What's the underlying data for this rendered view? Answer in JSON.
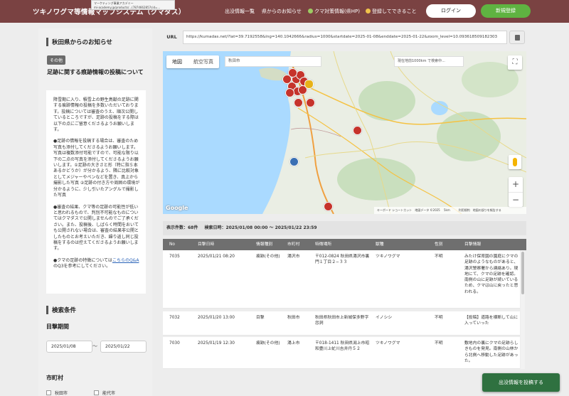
{
  "header": {
    "title": "ツキノワグマ等情報マップシステム（クマダス）",
    "tooltip_line1": "マーケティング事業アカデミー",
    "tooltip_line2": "mi-academy.jp/products/...(7874662857cid=...",
    "nav": [
      "出没情報一覧",
      "県からのお知らせ",
      "クマ対策情報(県HP)",
      "登録してできること"
    ],
    "login": "ログイン",
    "register": "新規登録"
  },
  "sidebar": {
    "title": "秋田県からのお知らせ",
    "badge": "その他",
    "notice_title": "足跡に関する痕跡情報の投稿について",
    "notice_paragraphs": [
      "降雪期に入り、積雪上の野生鳥獣の足跡に関する痕跡情報の投稿を多数いただいております。投稿については審査のうえ、順次公開しているところですが、足跡の投稿をする際は以下の点にご留意くださるようお願いします。",
      "●足跡の情報を投稿する場合は、審査のため写真も添付してくださるようお願いします。写真は複数添付可能ですので、可能な限り以下の二点の写真を添付してくださるようお願いします。①足跡の大きさと形（特に指５本あるかどうか）が分かるよう、隣に比較対象としてメジャーやペンなどを置き、真上から撮影した写真 ②足跡の付き方や周囲の環境が分かるように、少し引いたアングルで撮影した写真",
      "●審査の結果、クマ等の足跡の可能性が低いと思われるもので、判別不可能なものについてはクマダスで公開しませんのでご了承ください。また、投稿後、しばらく時間をおいても公開されない場合は、審査の結果非公開としたものとお考えいただき、繰り返し同じ投稿をするのは控えてくださるようお願いします。"
    ],
    "notice_last_prefix": "●クマの足跡の特徴については",
    "notice_link": "こちらのQ&A",
    "notice_last_suffix": "のQ3を参考にしてください。",
    "search_title": "検索条件",
    "period_label": "目撃期間",
    "date_from": "2025/01/08",
    "date_sep": "〜",
    "date_to": "2025/01/22",
    "city_label": "市町村",
    "cities": [
      "秋田市",
      "能代市"
    ]
  },
  "url": {
    "label": "URL",
    "value": "https://kumadas.net/?lat=39.7192558&lng=140.1042666&radius=1000&startdate=2025-01-08&enddate=2025-01-22&zoom_level=10.093618509182303"
  },
  "map": {
    "tab_map": "地図",
    "tab_satellite": "航空写真",
    "search_value": "秋田市",
    "radius_placeholder": "現在地前1000km で検索中...",
    "google": "Google",
    "attribution": "キーボード ショートカット　地図データ ©2025 　5km　　　利用規約　地図の誤りを報告する"
  },
  "summary": {
    "count": "表示件数：68件",
    "period": "検索日時：2025/01/08 00:00 〜 2025/01/22 23:59"
  },
  "table": {
    "headers": [
      "No",
      "目撃日時",
      "情報種別",
      "市町村",
      "特徴場所",
      "獣種",
      "性別",
      "目撃情報"
    ],
    "rows": [
      [
        "7035",
        "2025/01/21 08:20",
        "痕跡(その他)",
        "湯沢市",
        "〒012-0824 秋田県湯沢市裏門１丁目２−３３",
        "ツキノワグマ",
        "不明",
        "みたけ保育園の園庭にクマの足跡のようなものがあると、湯沢警察署から連絡あり。現地にて、クマの足跡を確認。南側の山に足跡が続いているため、クマは山に戻ったと思われる。"
      ],
      [
        "7032",
        "2025/01/20 13:00",
        "目撃",
        "秋田市",
        "秋田県秋田市上新城保多野字怨洞",
        "イノシシ",
        "不明",
        "【投稿】道路を横断して山に入っていった"
      ],
      [
        "7030",
        "2025/01/19 12:30",
        "痕跡(その他)",
        "湯上市",
        "〒018-1411 秋田県潟上市昭和豊川上虻川吉井丹５２",
        "ツキノワグマ",
        "不明",
        "敷地内の裏にクマの足跡らしきものを発見。南側の山林から北側へ移動した足跡があった。"
      ]
    ]
  },
  "post_button": "出没情報を投稿する",
  "colors": {
    "header_bg": "#7a4242",
    "register_green": "#5fb341",
    "post_green": "#2f7140",
    "marker_red": "#c6332b"
  }
}
